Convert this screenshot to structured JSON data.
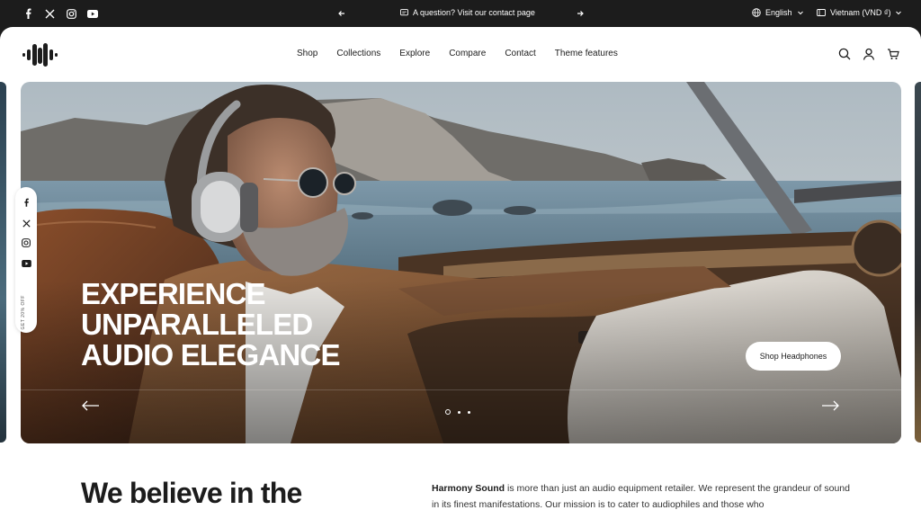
{
  "topbar": {
    "social_icons": [
      "facebook-icon",
      "x-icon",
      "instagram-icon",
      "youtube-icon"
    ],
    "announcement": "A question? Visit our contact page",
    "language": "English",
    "currency": "Vietnam (VND ₫)"
  },
  "header": {
    "nav": [
      "Shop",
      "Collections",
      "Explore",
      "Compare",
      "Contact",
      "Theme features"
    ],
    "icons": [
      "search-icon",
      "account-icon",
      "cart-icon"
    ]
  },
  "hero": {
    "title_lines": [
      "EXPERIENCE",
      "UNPARALLELED",
      "AUDIO ELEGANCE"
    ],
    "cta": "Shop Headphones",
    "slide_count": 3,
    "active_slide": 1
  },
  "floating_social": {
    "icons": [
      "facebook-icon",
      "x-icon",
      "instagram-icon",
      "youtube-icon"
    ],
    "promo": "GET 20% OFF"
  },
  "about": {
    "heading": "We believe in the",
    "brand": "Harmony Sound",
    "text": " is more than just an audio equipment retailer. We represent the grandeur of sound in its finest manifestations. Our mission is to cater to audiophiles and those who"
  },
  "colors": {
    "dark": "#1c1c1c",
    "white": "#ffffff"
  }
}
